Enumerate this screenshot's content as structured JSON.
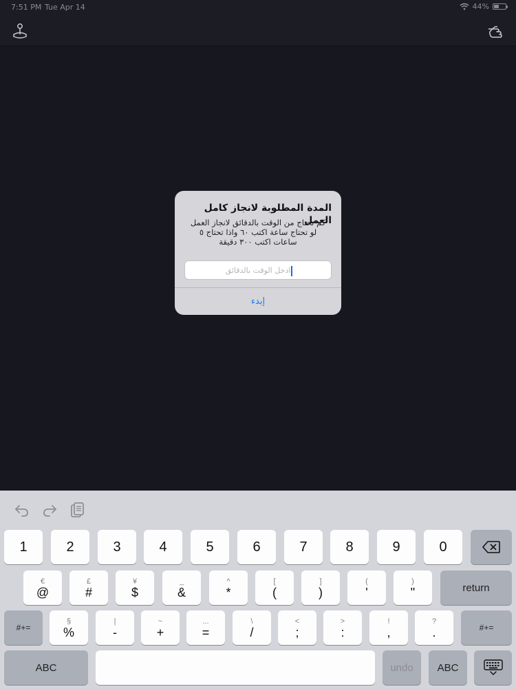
{
  "status": {
    "time": "7:51 PM",
    "date": "Tue Apr 14",
    "battery": "44%",
    "battery_level": 0.44
  },
  "nav": {
    "left_icon": "joystick-icon",
    "right_icon": "pointing-hand-icon"
  },
  "alert": {
    "title": "المدة المطلوبة لانجاز كامل العمل",
    "message": "كم تحتاج من الوقت بالدقائق لانجاز العمل لو تحتاج ساعة اكتب ٦٠ واذا تحتاج ٥ ساعات اكتب ٣٠٠ دقيقة",
    "input_value": "",
    "input_placeholder": "ادخل الوقت بالدقائق",
    "button": "إبدء"
  },
  "keyboard": {
    "toolbar": [
      "undo-arrow-icon",
      "redo-arrow-icon",
      "clipboard-paste-icon"
    ],
    "row1": [
      "1",
      "2",
      "3",
      "4",
      "5",
      "6",
      "7",
      "8",
      "9",
      "0"
    ],
    "row2": [
      {
        "alt": "€",
        "main": "@"
      },
      {
        "alt": "£",
        "main": "#"
      },
      {
        "alt": "¥",
        "main": "$"
      },
      {
        "alt": "_",
        "main": "&"
      },
      {
        "alt": "^",
        "main": "*"
      },
      {
        "alt": "[",
        "main": "("
      },
      {
        "alt": "]",
        "main": ")"
      },
      {
        "alt": "(",
        "main": "'"
      },
      {
        "alt": ")",
        "main": "\""
      }
    ],
    "row3": [
      {
        "alt": "§",
        "main": "%"
      },
      {
        "alt": "|",
        "main": "-"
      },
      {
        "alt": "~",
        "main": "+"
      },
      {
        "alt": "...",
        "main": "="
      },
      {
        "alt": "\\",
        "main": "/"
      },
      {
        "alt": "<",
        "main": ";"
      },
      {
        "alt": ">",
        "main": ":"
      },
      {
        "alt": "!",
        "main": ","
      },
      {
        "alt": "?",
        "main": "."
      }
    ],
    "return_label": "return",
    "shift_left": "#+=",
    "shift_right": "#+=",
    "abc_left": "ABC",
    "undo_label": "undo",
    "abc_right": "ABC"
  }
}
